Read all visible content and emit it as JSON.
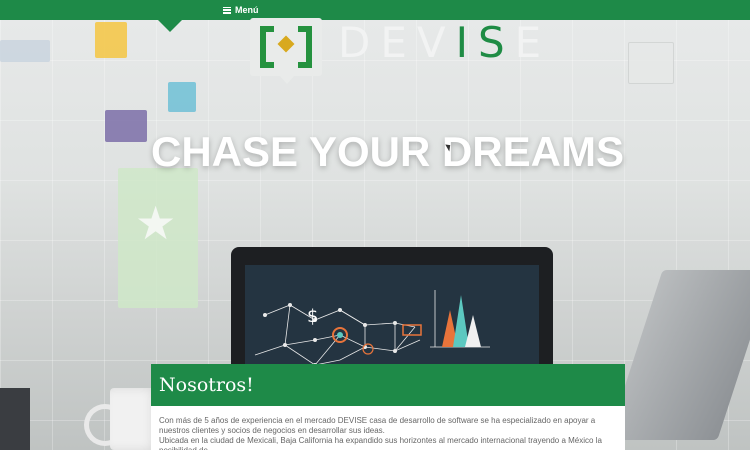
{
  "nav": {
    "menu_label": "Menú"
  },
  "brand": {
    "prefix": "DEV",
    "accent": "IS",
    "suffix": "E",
    "logo_icon": "devise-logo-icon"
  },
  "hero": {
    "headline": "CHASE YOUR DREAMS"
  },
  "about": {
    "title": "Nosotros!",
    "paragraphs": [
      "Con más de 5 años de experiencia en el mercado DEVISE casa de desarrollo de software se ha especializado en apoyar a nuestros clientes y socios de negocios en desarrollar sus ideas.",
      "Ubicada en la ciudad de Mexicali, Baja California ha expandido sus horizontes al mercado internacional trayendo a México la posibilidad de"
    ]
  },
  "colors": {
    "primary_green": "#1e8a48",
    "logo_gold": "#d8a91e"
  }
}
